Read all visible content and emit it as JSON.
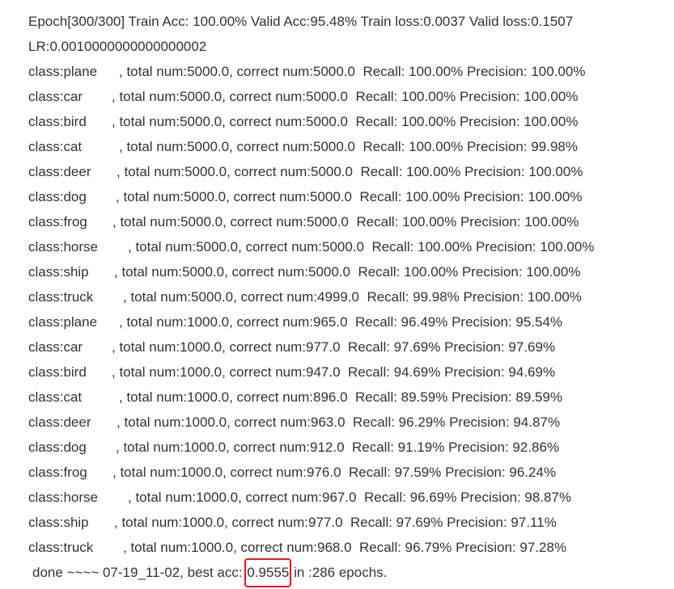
{
  "log": {
    "header_line": "Epoch[300/300] Train Acc: 100.00% Valid Acc:95.48% Train loss:0.0037 Valid loss:0.1507",
    "lr_line": "LR:0.0010000000000000002",
    "rows": [
      {
        "cls": "class:plane",
        "rest": ", total num:5000.0, correct num:5000.0  Recall: 100.00% Precision: 100.00%"
      },
      {
        "cls": "class:car",
        "rest": ", total num:5000.0, correct num:5000.0  Recall: 100.00% Precision: 100.00%"
      },
      {
        "cls": "class:bird",
        "rest": ", total num:5000.0, correct num:5000.0  Recall: 100.00% Precision: 100.00%"
      },
      {
        "cls": "class:cat",
        "rest": ", total num:5000.0, correct num:5000.0  Recall: 100.00% Precision: 99.98%"
      },
      {
        "cls": "class:deer",
        "rest": ", total num:5000.0, correct num:5000.0  Recall: 100.00% Precision: 100.00%"
      },
      {
        "cls": "class:dog",
        "rest": ", total num:5000.0, correct num:5000.0  Recall: 100.00% Precision: 100.00%"
      },
      {
        "cls": "class:frog",
        "rest": ", total num:5000.0, correct num:5000.0  Recall: 100.00% Precision: 100.00%"
      },
      {
        "cls": "class:horse",
        "rest": ", total num:5000.0, correct num:5000.0  Recall: 100.00% Precision: 100.00%"
      },
      {
        "cls": "class:ship",
        "rest": ", total num:5000.0, correct num:5000.0  Recall: 100.00% Precision: 100.00%"
      },
      {
        "cls": "class:truck",
        "rest": ", total num:5000.0, correct num:4999.0  Recall: 99.98% Precision: 100.00%"
      },
      {
        "cls": "class:plane",
        "rest": ", total num:1000.0, correct num:965.0  Recall: 96.49% Precision: 95.54%"
      },
      {
        "cls": "class:car",
        "rest": ", total num:1000.0, correct num:977.0  Recall: 97.69% Precision: 97.69%"
      },
      {
        "cls": "class:bird",
        "rest": ", total num:1000.0, correct num:947.0  Recall: 94.69% Precision: 94.69%"
      },
      {
        "cls": "class:cat",
        "rest": ", total num:1000.0, correct num:896.0  Recall: 89.59% Precision: 89.59%"
      },
      {
        "cls": "class:deer",
        "rest": ", total num:1000.0, correct num:963.0  Recall: 96.29% Precision: 94.87%"
      },
      {
        "cls": "class:dog",
        "rest": ", total num:1000.0, correct num:912.0  Recall: 91.19% Precision: 92.86%"
      },
      {
        "cls": "class:frog",
        "rest": ", total num:1000.0, correct num:976.0  Recall: 97.59% Precision: 96.24%"
      },
      {
        "cls": "class:horse",
        "rest": ", total num:1000.0, correct num:967.0  Recall: 96.69% Precision: 98.87%"
      },
      {
        "cls": "class:ship",
        "rest": ", total num:1000.0, correct num:977.0  Recall: 97.69% Precision: 97.11%"
      },
      {
        "cls": "class:truck",
        "rest": ", total num:1000.0, correct num:968.0  Recall: 96.79% Precision: 97.28%"
      }
    ],
    "done_prefix": "done ~~~~ 07-19_11-02, best acc: ",
    "best_acc": "0.9555",
    "done_suffix": " in :286 epochs."
  },
  "colors": {
    "text": "#333333",
    "highlight_border": "#e8161f"
  }
}
